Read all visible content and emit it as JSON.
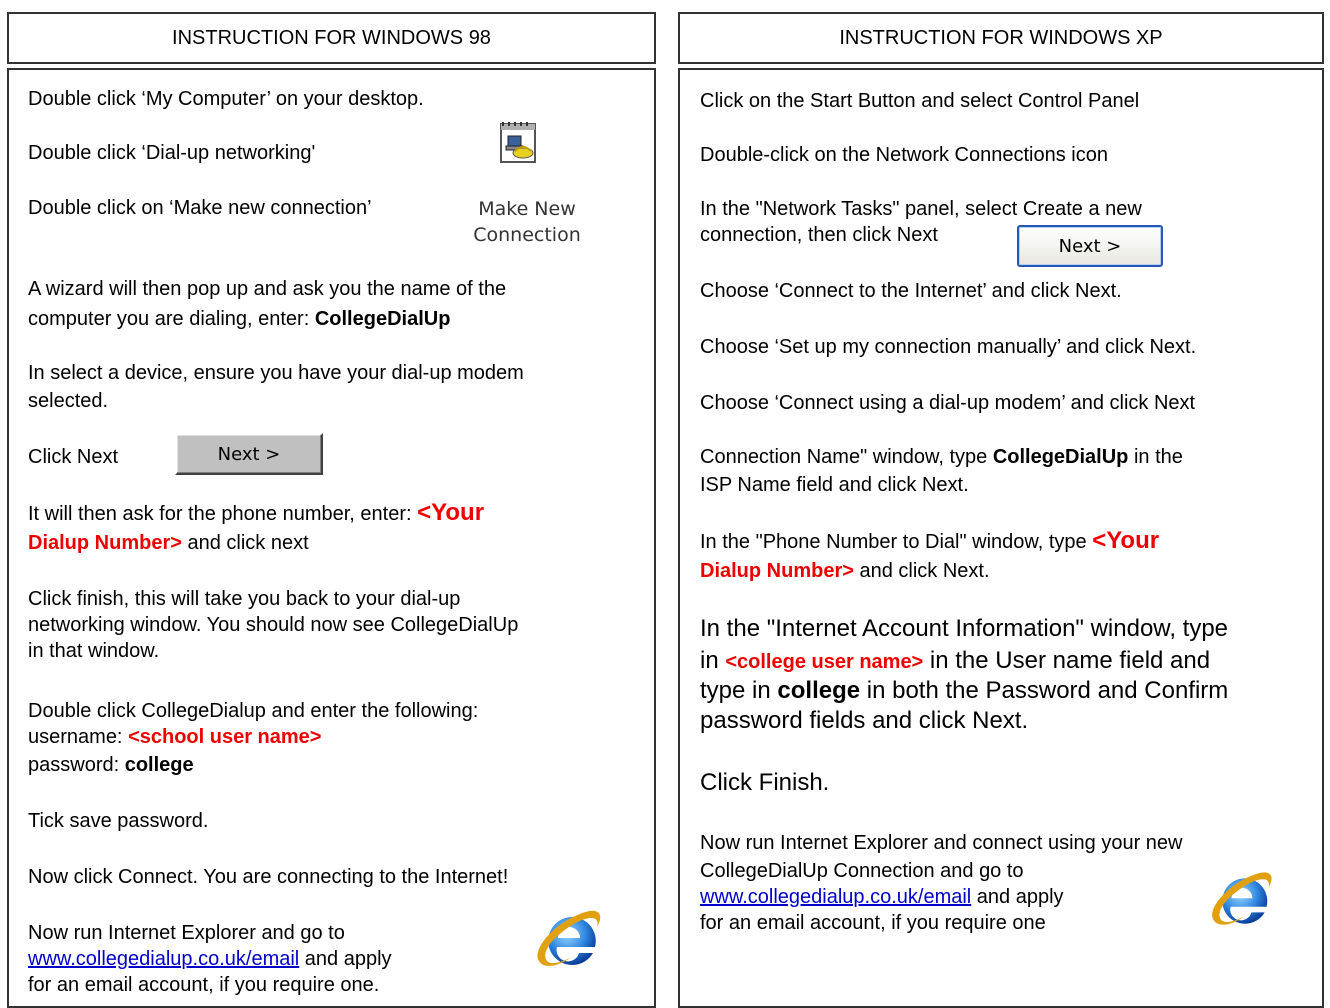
{
  "left": {
    "header": "INSTRUCTION FOR WINDOWS 98",
    "step1": "Double click ‘My Computer’ on your desktop.",
    "step2": "Double click ‘Dial-up networking'",
    "step3": "Double click on ‘Make new connection’",
    "icon_label_line1": "Make New",
    "icon_label_line2": "Connection",
    "step4_line1": "A wizard will then  pop up and ask you the name of the",
    "step4_line2_pre": "computer you are dialing, enter:  ",
    "step4_line2_bold": "CollegeDialUp",
    "step5_line1": "In select a device, ensure you have your dial-up modem",
    "step5_line2": "selected.",
    "step6": "Click Next",
    "next_button": "Next >",
    "step7_pre": "It will then ask for the phone number, enter: ",
    "step7_red1": "<Your",
    "step7_red2": "Dialup Number>",
    "step7_post": "  and click next",
    "step8_line1": "Click finish, this will take you back to your dial-up",
    "step8_line2": "networking window. You should now see CollegeDialUp",
    "step8_line3": "in that window.",
    "step9_line1": "Double click CollegeDialup and enter the following:",
    "step9_user_pre": "username: ",
    "step9_user_red": "<school user name>",
    "step9_pass_pre": "password: ",
    "step9_pass_bold": "college",
    "step10": "Tick save password.",
    "step11": "Now click Connect. You are connecting to the Internet!",
    "step12_line1": "Now run Internet Explorer and go to",
    "step12_link": "www.collegedialup.co.uk/email",
    "step12_link_post": " and apply",
    "step12_line3": "for an email account, if you require one."
  },
  "right": {
    "header": "INSTRUCTION FOR WINDOWS XP",
    "step1": "Click on the Start Button and select Control Panel",
    "step2": "Double-click on the Network Connections icon",
    "step3_line1": "In the \"Network Tasks\" panel, select Create a new",
    "step3_line2": "connection, then click Next",
    "next_button": "Next >",
    "step4": "Choose ‘Connect to the Internet’ and click Next.",
    "step5": "Choose ‘Set up my connection manually’ and click Next.",
    "step6": "Choose ‘Connect using a dial-up modem’ and click Next",
    "step7_pre": "Connection Name\" window, type ",
    "step7_bold": "CollegeDialUp",
    "step7_post": " in the",
    "step7_line2": "ISP Name field and click Next.",
    "step8_pre": "In the \"Phone Number to Dial\" window, type  ",
    "step8_red1": "<Your",
    "step8_red2": "Dialup Number>",
    "step8_post": " and click Next.",
    "step9_line1": "In the \"Internet Account Information\" window, type",
    "step9_pre": "in ",
    "step9_red": "<college user name>",
    "step9_post": " in the User name field and",
    "step9_line3_pre": "type in ",
    "step9_line3_bold": "college",
    "step9_line3_post": " in both the Password and Confirm",
    "step9_line4": "password fields and click Next.",
    "step10": "Click Finish.",
    "step11_line1": "Now run Internet Explorer and connect using your new",
    "step11_line2": "CollegeDialUp Connection and go to",
    "step11_link": "www.collegedialup.co.uk/email",
    "step11_link_post": " and apply",
    "step11_line4": "for an email account, if you require one"
  },
  "colors": {
    "red": "#ee0000",
    "link": "#0000cc",
    "border": "#333333"
  },
  "icons": [
    "make-new-connection-icon",
    "internet-explorer-icon"
  ]
}
